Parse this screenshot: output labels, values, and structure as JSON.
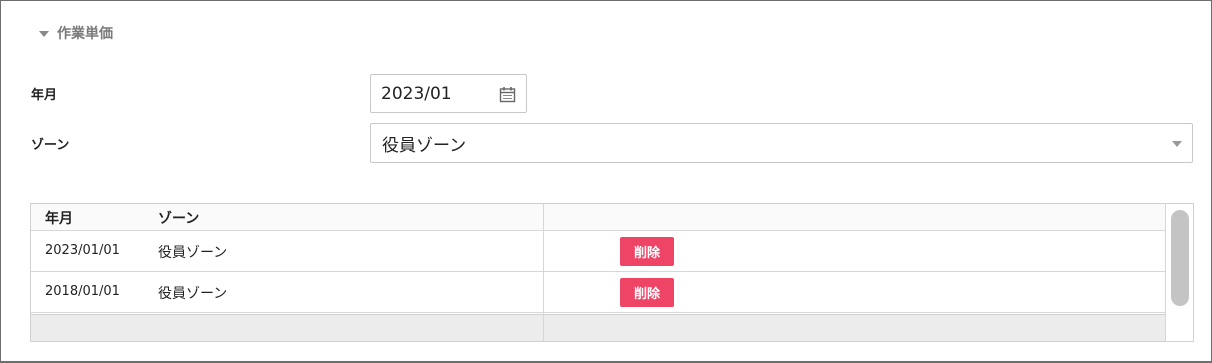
{
  "section": {
    "title": "作業単価",
    "icon": "triangle-down-icon"
  },
  "form": {
    "month_label": "年月",
    "month_value": "2023/01",
    "zone_label": "ゾーン",
    "zone_value": "役員ゾーン"
  },
  "table": {
    "headers": [
      "年月",
      "ゾーン",
      ""
    ],
    "rows": [
      {
        "month": "2023/01/01",
        "zone": "役員ゾーン",
        "delete_label": "削除"
      },
      {
        "month": "2018/01/01",
        "zone": "役員ゾーン",
        "delete_label": "削除"
      }
    ]
  },
  "colors": {
    "delete_button": "#ee4466",
    "section_title": "#7a7a7a"
  }
}
